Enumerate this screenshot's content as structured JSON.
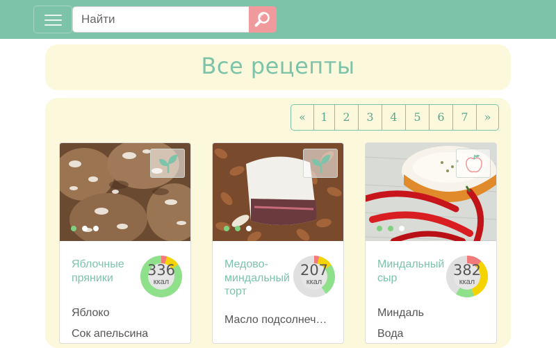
{
  "header": {
    "search_placeholder": "Найти",
    "menu_icon": "hamburger-icon",
    "search_icon": "magnifier-icon"
  },
  "title": "Все рецепты",
  "pagination": [
    "«",
    "1",
    "2",
    "3",
    "4",
    "5",
    "6",
    "7",
    "»"
  ],
  "colors": {
    "accent": "#7cc3aa",
    "panel": "#fbf8dc",
    "search_button": "#f09a9d",
    "protein": "#f27a7a",
    "fat": "#f5d300",
    "carbs": "#8ee08a",
    "ring_rest": "#e0e0e0"
  },
  "recipes": [
    {
      "name": "Яблочные\nпряники",
      "kcal": "336",
      "kcal_unit": "ккал",
      "badge_icon": "sprout-icon",
      "photo": "crinkle-cookies",
      "ingredients": [
        "Яблоко",
        "Сок апельсина"
      ],
      "macros": {
        "protein": 0.05,
        "fat": 0.12,
        "carbs": 0.83
      },
      "slides": 3,
      "active_slide": 0
    },
    {
      "name": "Медово-\nминдальный\nторт",
      "kcal": "207",
      "kcal_unit": "ккал",
      "badge_icon": "sprout-icon",
      "photo": "almond-cake",
      "ingredients": [
        "Масло подсолнечное"
      ],
      "macros": {
        "protein": 0.04,
        "fat": 0.12,
        "carbs": 0.32
      },
      "slides": 3,
      "active_slide": 1
    },
    {
      "name": "Миндальный\nсыр",
      "kcal": "382",
      "kcal_unit": "ккал",
      "badge_icon": "apple-icon",
      "photo": "almond-cheese",
      "ingredients": [
        "Миндаль",
        "Вода"
      ],
      "macros": {
        "protein": 0.15,
        "fat": 0.3,
        "carbs": 0.18
      },
      "slides": 3,
      "active_slide": 1
    }
  ]
}
